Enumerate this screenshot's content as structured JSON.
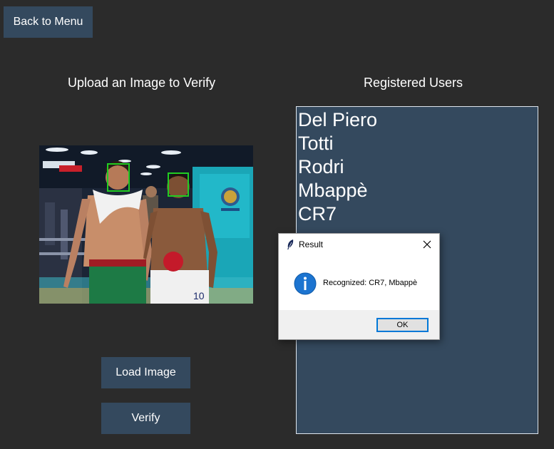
{
  "buttons": {
    "back": "Back to Menu",
    "load": "Load Image",
    "verify": "Verify"
  },
  "upload_panel": {
    "title": "Upload an Image to Verify",
    "image_description": "photo"
  },
  "users_panel": {
    "title": "Registered Users",
    "users": [
      "Del Piero",
      "Totti",
      "Rodri",
      "Mbappè",
      "CR7"
    ]
  },
  "dialog": {
    "title": "Result",
    "message": "Recognized: CR7, Mbappè",
    "ok_label": "OK",
    "icon": "info-icon"
  },
  "colors": {
    "background": "#2b2b2b",
    "button": "#34495e",
    "listbox": "#34495e",
    "face_box": "#22cc22",
    "dialog_accent": "#0078d7"
  }
}
